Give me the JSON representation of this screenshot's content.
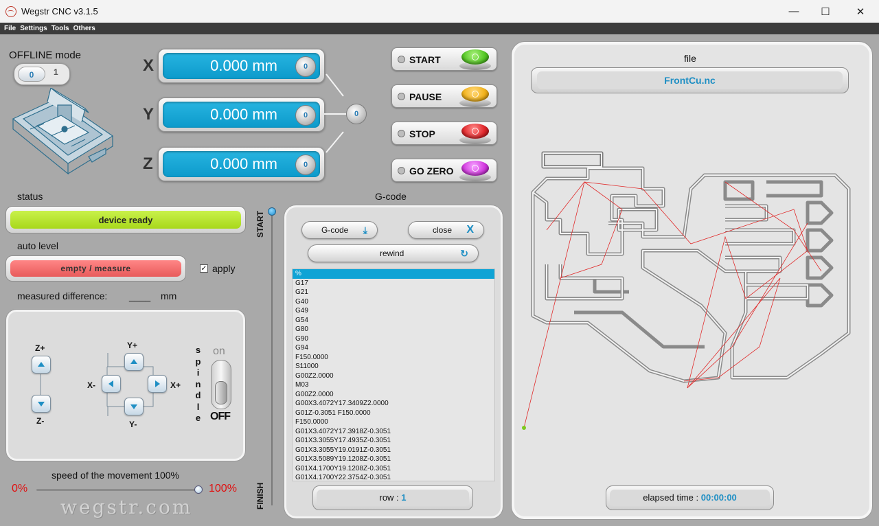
{
  "window": {
    "title": "Wegstr CNC  v3.1.5",
    "minimize": "—",
    "maximize": "☐",
    "close": "✕"
  },
  "menu": [
    "File",
    "Settings",
    "Tools",
    "Others"
  ],
  "offline": {
    "label": "OFFLINE mode",
    "off": "0",
    "on": "1"
  },
  "axes": [
    {
      "name": "X",
      "value": "0.000 mm",
      "zero": "0"
    },
    {
      "name": "Y",
      "value": "0.000 mm",
      "zero": "0"
    },
    {
      "name": "Z",
      "value": "0.000 mm",
      "zero": "0"
    }
  ],
  "zero_all": "0",
  "controls": [
    {
      "label": "START",
      "color": "#55c825"
    },
    {
      "label": "PAUSE",
      "color": "#f2b21a"
    },
    {
      "label": "STOP",
      "color": "#e0262a"
    },
    {
      "label": "GO ZERO",
      "color": "#d33ae0"
    }
  ],
  "status": {
    "label": "status",
    "value": "device ready",
    "color": "#b5e22a"
  },
  "auto_level": {
    "label": "auto level",
    "button": "empty / measure",
    "apply_label": "apply",
    "apply_checked": true,
    "checkmark": "✓"
  },
  "measured": {
    "label": "measured difference:",
    "value": "____",
    "unit": "mm"
  },
  "jog": {
    "z_plus": "Z+",
    "z_minus": "Z-",
    "y_plus": "Y+",
    "y_minus": "Y-",
    "x_plus": "X+",
    "x_minus": "X-"
  },
  "spindle": {
    "label": "spindle",
    "on": "on",
    "off": "OFF",
    "state": "off"
  },
  "speed": {
    "label": "speed of the movement 100%",
    "min": "0%",
    "max": "100%",
    "value_percent": 100
  },
  "watermark": "wegstr.com",
  "progress": {
    "start": "START",
    "finish": "FINISH"
  },
  "gcode": {
    "title": "G-code",
    "load_button": "G-code",
    "load_icon": "⤓",
    "close_button": "close",
    "close_icon": "X",
    "rewind_button": "rewind",
    "rewind_icon": "↻",
    "lines": [
      "%",
      "G17",
      "G21",
      "G40",
      "G49",
      "G54",
      "G80",
      "G90",
      "G94",
      "F150.0000",
      "S11000",
      "G00Z2.0000",
      "M03",
      "G00Z2.0000",
      "G00X3.4072Y17.3409Z2.0000",
      "G01Z-0.3051 F150.0000",
      "F150.0000",
      "G01X3.4072Y17.3918Z-0.3051",
      "G01X3.3055Y17.4935Z-0.3051",
      "G01X3.3055Y19.0191Z-0.3051",
      "G01X3.5089Y19.1208Z-0.3051",
      "G01X4.1700Y19.1208Z-0.3051",
      "G01X4.1700Y22.3754Z-0.3051"
    ],
    "selected_index": 0,
    "row_label": "row : ",
    "row_value": "1"
  },
  "file": {
    "label": "file",
    "name": "FrontCu.nc",
    "elapsed_label": "elapsed time : ",
    "elapsed_value": "00:00:00"
  }
}
